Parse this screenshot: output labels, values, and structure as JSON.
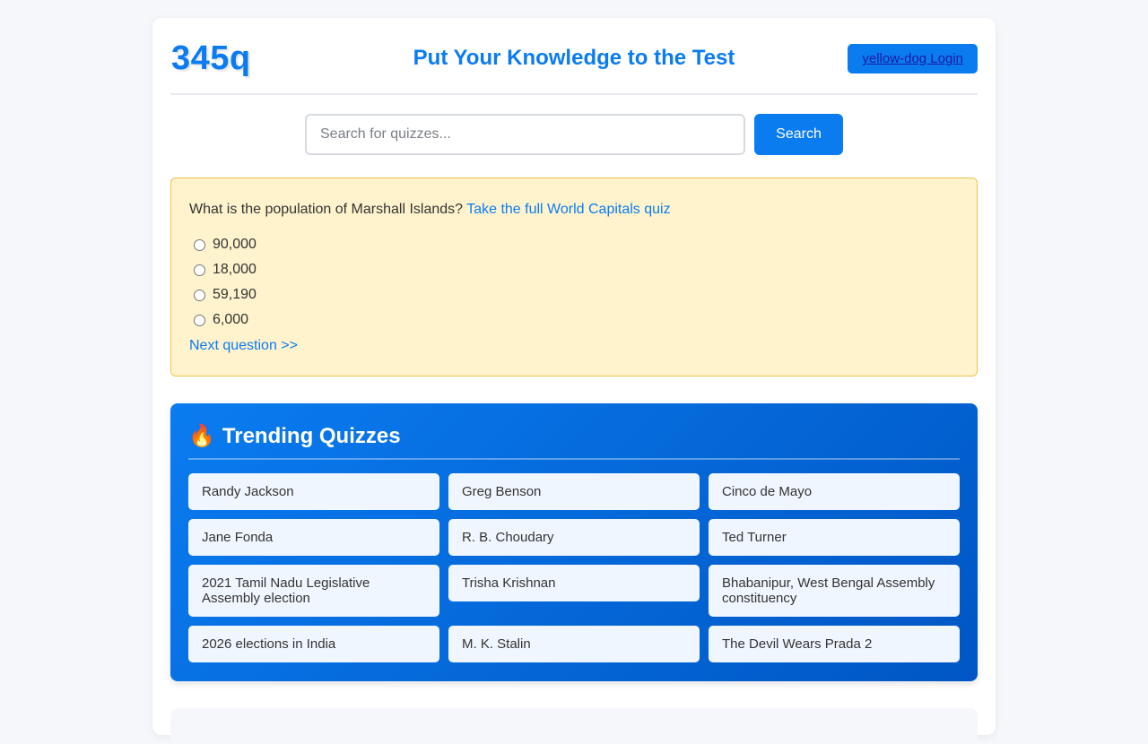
{
  "header": {
    "logo": "345q",
    "tagline": "Put Your Knowledge to the Test",
    "login_label": "yellow-dog Login"
  },
  "search": {
    "placeholder": "Search for quizzes...",
    "value": "",
    "button_label": "Search"
  },
  "question": {
    "text": "What is the population of Marshall Islands?",
    "quiz_link": "Take the full World Capitals quiz",
    "options": [
      "90,000",
      "18,000",
      "59,190",
      "6,000"
    ],
    "next_label": "Next question >>"
  },
  "trending": {
    "icon": "fire-icon",
    "title": "Trending Quizzes",
    "items": [
      "Randy Jackson",
      "Greg Benson",
      "Cinco de Mayo",
      "Jane Fonda",
      "R. B. Choudary",
      "Ted Turner",
      "2021 Tamil Nadu Legislative Assembly election",
      "Trisha Krishnan",
      "Bhabanipur, West Bengal Assembly constituency",
      "2026 elections in India",
      "M. K. Stalin",
      "The Devil Wears Prada 2"
    ]
  },
  "colors": {
    "accent": "#0a7cf0",
    "question_bg": "#fff3cd",
    "question_border": "#f0c14b",
    "card_bg": "#f0f6ff"
  }
}
